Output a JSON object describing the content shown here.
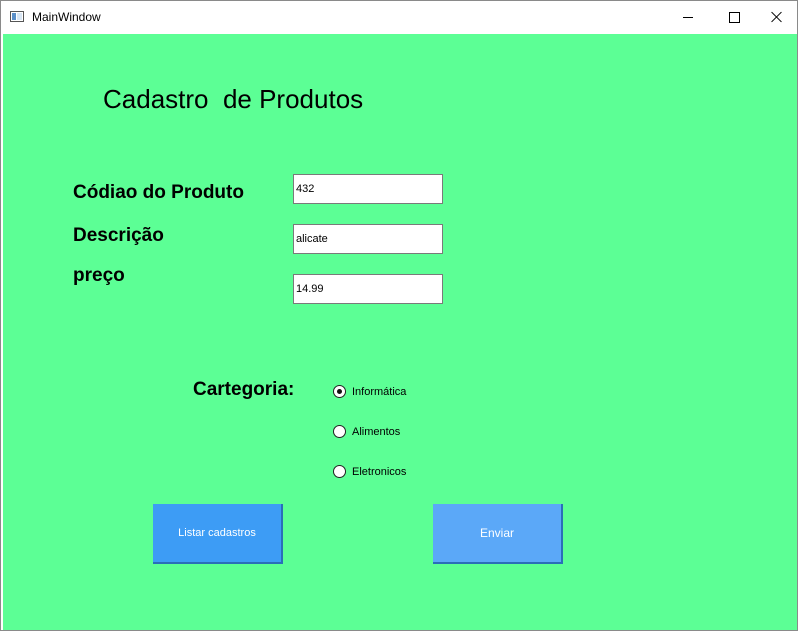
{
  "window": {
    "title": "MainWindow"
  },
  "form": {
    "heading": "Cadastro  de Produtos",
    "labels": {
      "code": "Códiao do Produto",
      "description": "Descrição",
      "price": "preço",
      "category": "Cartegoria:"
    },
    "fields": {
      "code": "432",
      "description": "alicate",
      "price": "14.99"
    },
    "categories": [
      {
        "label": "Informática",
        "selected": true
      },
      {
        "label": "Alimentos",
        "selected": false
      },
      {
        "label": "Eletronicos",
        "selected": false
      }
    ],
    "buttons": {
      "list": "Listar cadastros",
      "send": "Enviar"
    }
  },
  "colors": {
    "background": "#5cff95",
    "button_list": "#3d9cf5",
    "button_send": "#5ba8f8"
  }
}
